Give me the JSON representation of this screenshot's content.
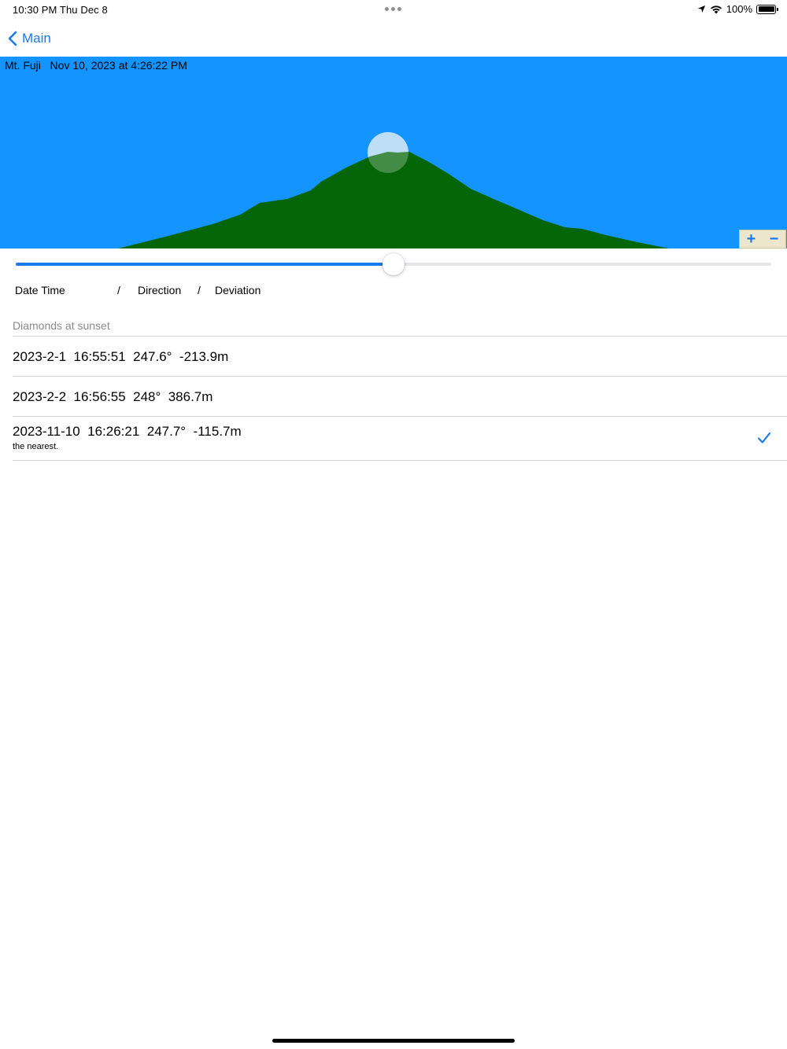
{
  "status_bar": {
    "time": "10:30 PM   Thu Dec 8",
    "battery": "100%"
  },
  "nav": {
    "back_label": "Main"
  },
  "scene": {
    "caption": "Mt. Fuji   Nov 10, 2023 at 4:26:22 PM",
    "sky_color": "#1494fe",
    "mountain_color": "#056608",
    "sun_color": "#a9d3f5"
  },
  "zoom": {
    "plus": "+",
    "minus": "−"
  },
  "slider": {
    "value": 0.5
  },
  "columns": {
    "date_time": "Date Time",
    "sep1": "/",
    "direction": "Direction",
    "sep2": "/",
    "deviation": "Deviation"
  },
  "list": {
    "section_title": "Diamonds at sunset",
    "rows": [
      {
        "text": "2023-2-1  16:55:51  247.6°  -213.9m",
        "subtitle": ""
      },
      {
        "text": "2023-2-2  16:56:55  248°  386.7m",
        "subtitle": ""
      },
      {
        "text": "2023-11-10  16:26:21  247.7°  -115.7m",
        "subtitle": "the nearest.",
        "checked": true
      }
    ]
  },
  "accent_color": "#1a7aef"
}
